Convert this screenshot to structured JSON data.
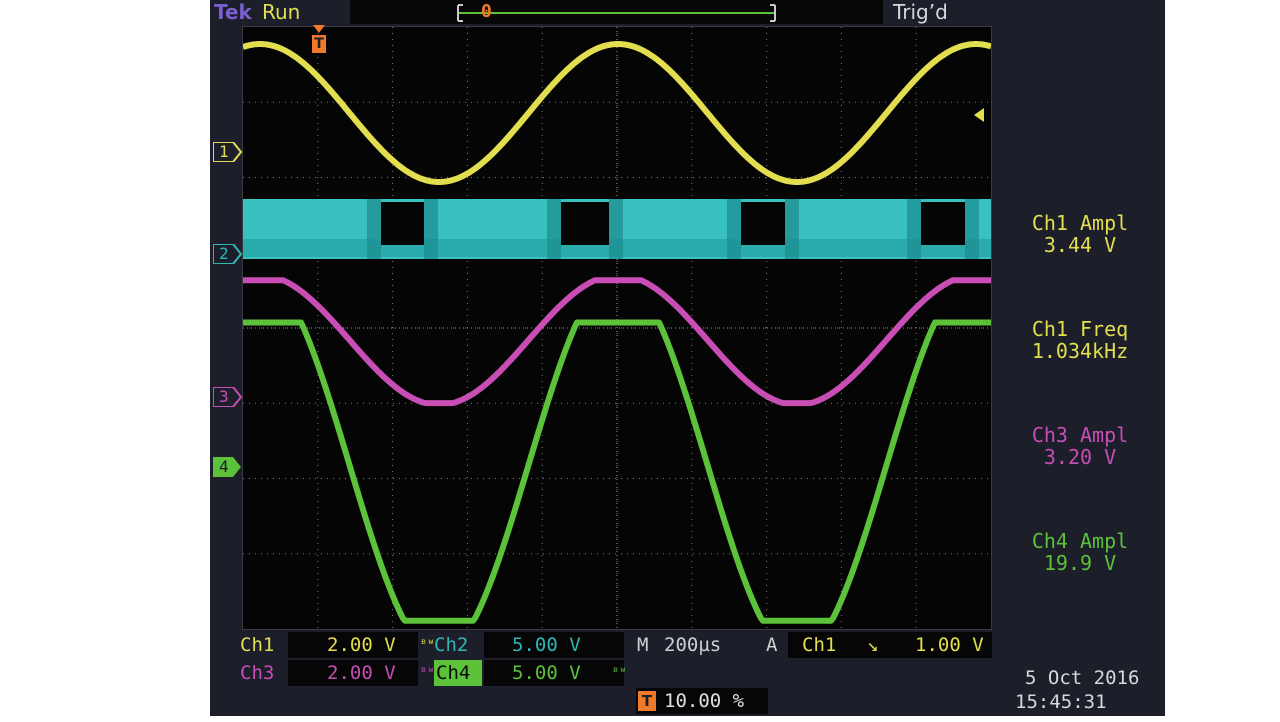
{
  "header": {
    "brand": "Tek",
    "run_state": "Run",
    "trigger_state": "Trig’d"
  },
  "markers": {
    "trigger_pos": "T",
    "record_trigger": "0",
    "ch1": "1",
    "ch2": "2",
    "ch3": "3",
    "ch4": "4"
  },
  "measurements": [
    {
      "label": "Ch1 Ampl",
      "value": "3.44 V",
      "color": "#e3de4f"
    },
    {
      "label": "Ch1 Freq",
      "value": "1.034kHz",
      "color": "#e3de4f"
    },
    {
      "label": "Ch3 Ampl",
      "value": "3.20 V",
      "color": "#c84db4"
    },
    {
      "label": "Ch4 Ampl",
      "value": "19.9 V",
      "color": "#5bc23a"
    }
  ],
  "channels": {
    "ch1": {
      "label": "Ch1",
      "scale": "2.00 V",
      "color": "#e3de4f"
    },
    "ch2": {
      "label": "Ch2",
      "scale": "5.00 V",
      "color": "#2fb6b6"
    },
    "ch3": {
      "label": "Ch3",
      "scale": "2.00 V",
      "color": "#c84db4"
    },
    "ch4": {
      "label": "Ch4",
      "scale": "5.00 V",
      "color": "#5bc23a"
    }
  },
  "bw_symbol": "ᴮᵂ",
  "timebase": {
    "m_label": "M",
    "value": "200µs"
  },
  "trigger": {
    "a_label": "A",
    "source": "Ch1",
    "slope_symbol": "↘",
    "level": "1.00 V"
  },
  "trigger_position": {
    "icon": "T",
    "value": "10.00 %"
  },
  "date": "5 Oct  2016",
  "time": "15:45:31"
}
